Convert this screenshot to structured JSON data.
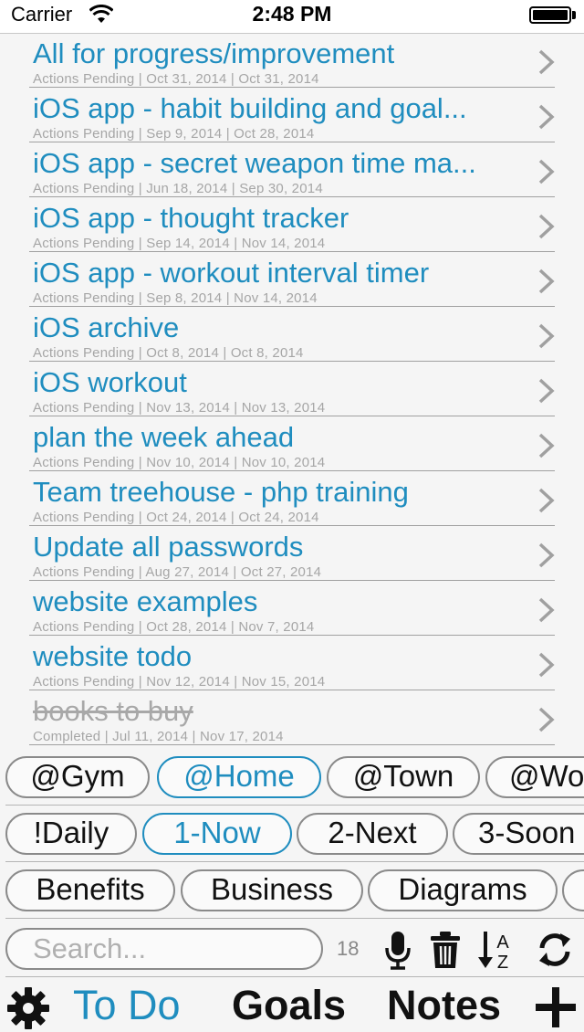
{
  "status_bar": {
    "carrier": "Carrier",
    "time": "2:48 PM",
    "icons": [
      "wifi-icon",
      "battery-icon"
    ]
  },
  "projects": [
    {
      "title": "All for progress/improvement",
      "status": "Actions Pending",
      "start": "Oct 31, 2014",
      "end": "Oct 31, 2014",
      "subtitle": "Actions Pending | Oct 31, 2014 | Oct 31, 2014",
      "completed": false
    },
    {
      "title": "iOS app - habit building and goal...",
      "status": "Actions Pending",
      "start": "Sep 9, 2014",
      "end": "Oct 28, 2014",
      "subtitle": "Actions Pending | Sep 9, 2014 | Oct 28, 2014",
      "completed": false
    },
    {
      "title": "iOS app - secret weapon time ma...",
      "status": "Actions Pending",
      "start": "Jun 18, 2014",
      "end": "Sep 30, 2014",
      "subtitle": "Actions Pending | Jun 18, 2014 | Sep 30, 2014",
      "completed": false
    },
    {
      "title": "iOS app - thought tracker",
      "status": "Actions Pending",
      "start": "Sep 14, 2014",
      "end": "Nov 14, 2014",
      "subtitle": "Actions Pending | Sep 14, 2014 | Nov 14, 2014",
      "completed": false
    },
    {
      "title": "iOS app - workout interval timer",
      "status": "Actions Pending",
      "start": "Sep 8, 2014",
      "end": "Nov 14, 2014",
      "subtitle": "Actions Pending | Sep 8, 2014 | Nov 14, 2014",
      "completed": false
    },
    {
      "title": "iOS archive",
      "status": "Actions Pending",
      "start": "Oct 8, 2014",
      "end": "Oct 8, 2014",
      "subtitle": "Actions Pending | Oct 8, 2014 | Oct 8, 2014",
      "completed": false
    },
    {
      "title": "iOS workout",
      "status": "Actions Pending",
      "start": "Nov 13, 2014",
      "end": "Nov 13, 2014",
      "subtitle": "Actions Pending | Nov 13, 2014 | Nov 13, 2014",
      "completed": false
    },
    {
      "title": "plan the week ahead",
      "status": "Actions Pending",
      "start": "Nov 10, 2014",
      "end": "Nov 10, 2014",
      "subtitle": "Actions Pending | Nov 10, 2014 | Nov 10, 2014",
      "completed": false
    },
    {
      "title": "Team treehouse - php training",
      "status": "Actions Pending",
      "start": "Oct 24, 2014",
      "end": "Oct 24, 2014",
      "subtitle": "Actions Pending | Oct 24, 2014 | Oct 24, 2014",
      "completed": false
    },
    {
      "title": "Update all passwords",
      "status": "Actions Pending",
      "start": "Aug 27, 2014",
      "end": "Oct 27, 2014",
      "subtitle": "Actions Pending | Aug 27, 2014 | Oct 27, 2014",
      "completed": false
    },
    {
      "title": "website examples",
      "status": "Actions Pending",
      "start": "Oct 28, 2014",
      "end": "Nov 7, 2014",
      "subtitle": "Actions Pending | Oct 28, 2014 | Nov 7, 2014",
      "completed": false
    },
    {
      "title": "website todo",
      "status": "Actions Pending",
      "start": "Nov 12, 2014",
      "end": "Nov 15, 2014",
      "subtitle": "Actions Pending | Nov 12, 2014 | Nov 15, 2014",
      "completed": false
    },
    {
      "title": "books to buy",
      "status": "Completed",
      "start": "Jul 11, 2014",
      "end": "Nov 17, 2014",
      "subtitle": "Completed | Jul 11, 2014 | Nov 17, 2014",
      "completed": true
    }
  ],
  "contexts": [
    {
      "label": "@Gym",
      "selected": false
    },
    {
      "label": "@Home",
      "selected": true
    },
    {
      "label": "@Town",
      "selected": false
    },
    {
      "label": "@Wo",
      "selected": false
    }
  ],
  "priorities": [
    {
      "label": "!Daily",
      "selected": false
    },
    {
      "label": "1-Now",
      "selected": true
    },
    {
      "label": "2-Next",
      "selected": false
    },
    {
      "label": "3-Soon",
      "selected": false
    }
  ],
  "categories": [
    {
      "label": "Benefits",
      "selected": false
    },
    {
      "label": "Business",
      "selected": false
    },
    {
      "label": "Diagrams",
      "selected": false
    },
    {
      "label": "",
      "selected": false
    }
  ],
  "search": {
    "placeholder": "Search...",
    "value": "",
    "count": "18"
  },
  "toolbar": {
    "icons": [
      "microphone-icon",
      "trash-icon",
      "sort-az-icon",
      "refresh-icon"
    ]
  },
  "tabs": {
    "settings_icon": "gear-icon",
    "todo": "To Do",
    "goals": "Goals",
    "notes": "Notes",
    "add_icon": "plus-icon",
    "active": "todo"
  },
  "colors": {
    "accent": "#1f8dbf",
    "completed_text": "#a8a8a8",
    "subtitle_text": "#a6a6a6",
    "pill_border": "#8a8a8a",
    "background": "#f5f5f5"
  }
}
